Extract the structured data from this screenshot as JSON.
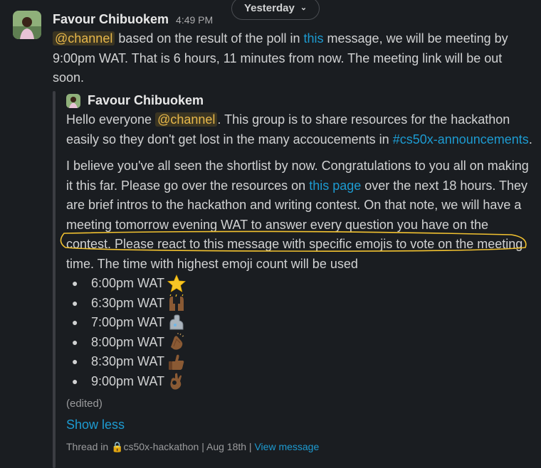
{
  "date_divider": {
    "label": "Yesterday"
  },
  "message": {
    "author": "Favour Chibuokem",
    "time": "4:49 PM",
    "mention": "@channel",
    "text_1": " based on the result of the poll in ",
    "link": "this",
    "text_2": " message, we will be meeting by 9:00pm WAT. That is 6 hours, 11 minutes from now. The meeting link will be out soon."
  },
  "quoted": {
    "author": "Favour Chibuokem",
    "p1_a": "Hello everyone ",
    "mention": "@channel",
    "p1_b": ". This group is to share resources for the hackathon easily so they don't get lost in the many accoucements in ",
    "channel_link": "#cs50x-announcements",
    "p1_c": ".",
    "p2_a": "I believe you've all seen the shortlist by now. Congratulations to you all on making it this far. Please go over the resources on ",
    "p2_link": "this page",
    "p2_b": " over the next 18 hours. They are brief intros to the hackathon and writing contest. On that note, we will have a meeting tomorrow evening WAT to answer every question you have on the contest. Please react to this message with specific emojis to vote on the meeting time. The time with highest emoji count will be used",
    "options": [
      {
        "time": "6:00pm WAT",
        "emoji": "star-emoji"
      },
      {
        "time": "6:30pm WAT",
        "emoji": "raised-hands-emoji"
      },
      {
        "time": "7:00pm WAT",
        "emoji": "mechanical-arm-emoji"
      },
      {
        "time": "8:00pm WAT",
        "emoji": "clapping-hands-emoji"
      },
      {
        "time": "8:30pm WAT",
        "emoji": "thumbs-up-emoji"
      },
      {
        "time": "9:00pm WAT",
        "emoji": "ok-hand-emoji"
      }
    ],
    "bullet": "●",
    "edited": "(edited)",
    "show_less": "Show less",
    "footer_a": "Thread in ",
    "footer_channel": "cs50x-hackathon",
    "footer_sep1": " | ",
    "footer_date": "Aug 18th",
    "footer_sep2": " | ",
    "footer_view": "View message"
  },
  "colors": {
    "background": "#1a1d21",
    "mention_bg": "#3b3522",
    "mention_fg": "#e8b84a",
    "link": "#1d9bd1",
    "annotation": "#f2c230"
  }
}
